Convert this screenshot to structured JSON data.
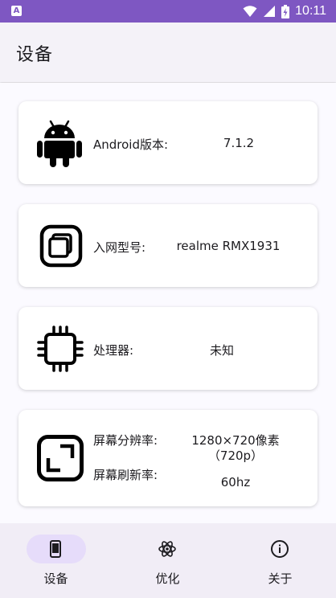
{
  "status_bar": {
    "app_badge": "A",
    "time": "10:11",
    "icons": [
      "wifi-icon",
      "signal-icon",
      "battery-charging-icon"
    ]
  },
  "app_bar": {
    "title": "设备"
  },
  "cards": {
    "android": {
      "icon": "android-icon",
      "label": "Android版本:",
      "value": "7.1.2"
    },
    "model": {
      "icon": "layers-icon",
      "label": "入网型号:",
      "value": "realme RMX1931"
    },
    "cpu": {
      "icon": "cpu-chip-icon",
      "label": "处理器:",
      "value": "未知"
    },
    "screen": {
      "icon": "screen-resize-icon",
      "resolution_label": "屏幕分辨率:",
      "resolution_value": "1280×720像素",
      "resolution_sub": "（720p）",
      "refresh_label": "屏幕刷新率:",
      "refresh_value": "60hz"
    }
  },
  "bottom_nav": {
    "items": [
      {
        "label": "设备",
        "icon": "phone-icon",
        "active": true
      },
      {
        "label": "优化",
        "icon": "atom-icon",
        "active": false
      },
      {
        "label": "关于",
        "icon": "info-icon",
        "active": false
      }
    ]
  },
  "colors": {
    "status_bar": "#7e57c2",
    "nav_active_pill": "#e6dcfa"
  }
}
